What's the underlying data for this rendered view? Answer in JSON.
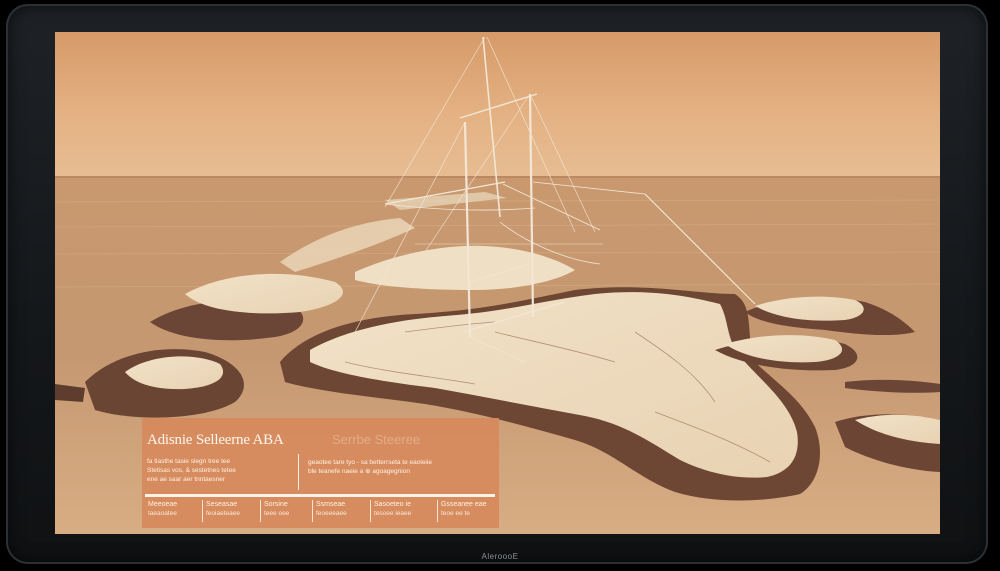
{
  "device": {
    "brand": "AleroooE"
  },
  "panel": {
    "title": "Adisnie Selleerne ABA",
    "faint_title": "Serrbe Steeree",
    "left_lines": [
      "fa tlasthe tasie slegn tree tee",
      "Stetisas vos, & sestetnes tetee",
      "ene ae saar aer tnntaesner"
    ],
    "right_lines": [
      "geaotee tare tyo - sa betterrseta te eaoleiie",
      "ble teanefe naeie a ⊕ agoagegnion"
    ],
    "tabs": [
      {
        "label": "Meeoeae",
        "sub": "taeaoatee"
      },
      {
        "label": "Seseasae",
        "sub": "feoiaeteaee"
      },
      {
        "label": "Sorsine",
        "sub": "teee oee"
      },
      {
        "label": "Ssmseae",
        "sub": "feoeeeaee"
      },
      {
        "label": "Sasoeteo ie",
        "sub": "tesoee ieaee"
      },
      {
        "label": "Gsseanee eae",
        "sub": "teoe ee te"
      }
    ]
  },
  "colors": {
    "sky_top": "#d9a270",
    "sky_horizon": "#e7b78a",
    "sea": "#b98a67",
    "land_light": "#efdcc0",
    "rock": "#6f4a36",
    "panel": "#d68a5c",
    "bezel": "#1a1d20"
  }
}
